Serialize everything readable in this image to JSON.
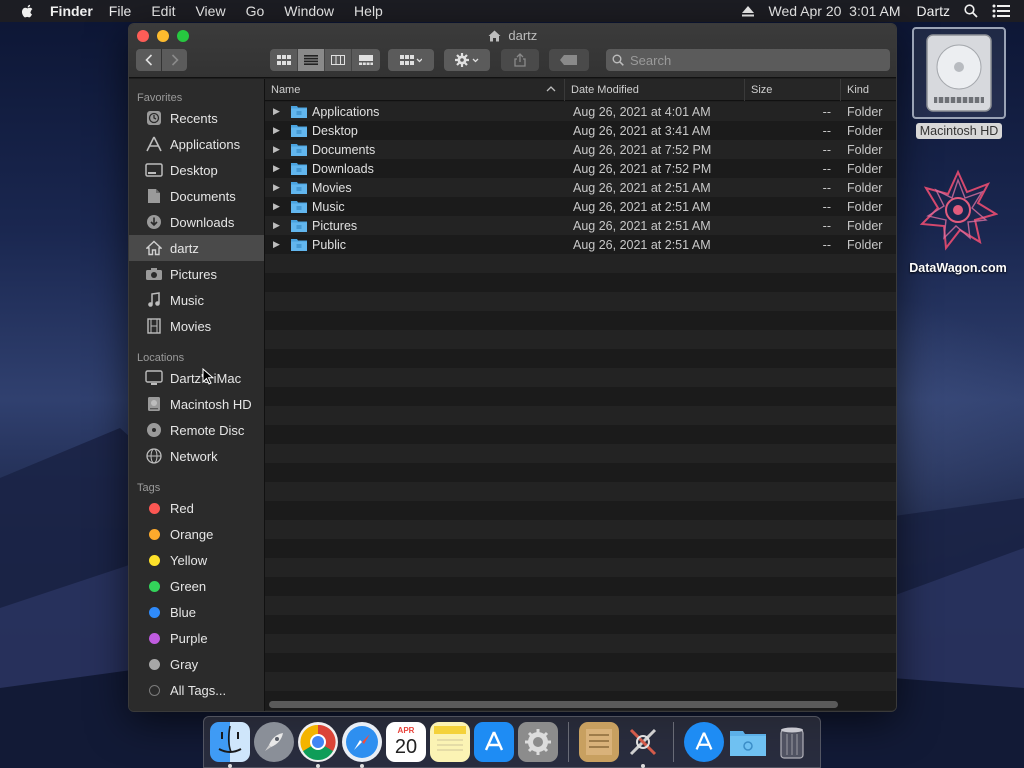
{
  "menubar": {
    "app_name": "Finder",
    "menus": [
      "File",
      "Edit",
      "View",
      "Go",
      "Window",
      "Help"
    ],
    "clock": "Wed Apr 20  3:01 AM",
    "user": "Dartz"
  },
  "window": {
    "title": "dartz",
    "search_placeholder": "Search"
  },
  "sidebar": {
    "favorites_header": "Favorites",
    "favorites": [
      {
        "label": "Recents",
        "icon": "clock-icon"
      },
      {
        "label": "Applications",
        "icon": "applications-icon"
      },
      {
        "label": "Desktop",
        "icon": "desktop-icon"
      },
      {
        "label": "Documents",
        "icon": "document-icon"
      },
      {
        "label": "Downloads",
        "icon": "download-icon"
      },
      {
        "label": "dartz",
        "icon": "home-icon"
      },
      {
        "label": "Pictures",
        "icon": "camera-icon"
      },
      {
        "label": "Music",
        "icon": "music-note-icon"
      },
      {
        "label": "Movies",
        "icon": "film-icon"
      }
    ],
    "locations_header": "Locations",
    "locations": [
      {
        "label": "Dartz's iMac",
        "icon": "imac-icon"
      },
      {
        "label": "Macintosh HD",
        "icon": "harddisk-icon"
      },
      {
        "label": "Remote Disc",
        "icon": "disc-icon"
      },
      {
        "label": "Network",
        "icon": "globe-icon"
      }
    ],
    "tags_header": "Tags",
    "tags": [
      {
        "label": "Red",
        "color": "#fc5753"
      },
      {
        "label": "Orange",
        "color": "#fdaa2c"
      },
      {
        "label": "Yellow",
        "color": "#fde12a"
      },
      {
        "label": "Green",
        "color": "#33d35a"
      },
      {
        "label": "Blue",
        "color": "#2f8bfb"
      },
      {
        "label": "Purple",
        "color": "#c05ce0"
      },
      {
        "label": "Gray",
        "color": "#a7a7a7"
      }
    ],
    "all_tags": "All Tags..."
  },
  "columns": {
    "name": "Name",
    "date": "Date Modified",
    "size": "Size",
    "kind": "Kind"
  },
  "files": [
    {
      "name": "Applications",
      "date": "Aug 26, 2021 at 4:01 AM",
      "size": "--",
      "kind": "Folder"
    },
    {
      "name": "Desktop",
      "date": "Aug 26, 2021 at 3:41 AM",
      "size": "--",
      "kind": "Folder"
    },
    {
      "name": "Documents",
      "date": "Aug 26, 2021 at 7:52 PM",
      "size": "--",
      "kind": "Folder"
    },
    {
      "name": "Downloads",
      "date": "Aug 26, 2021 at 7:52 PM",
      "size": "--",
      "kind": "Folder"
    },
    {
      "name": "Movies",
      "date": "Aug 26, 2021 at 2:51 AM",
      "size": "--",
      "kind": "Folder"
    },
    {
      "name": "Music",
      "date": "Aug 26, 2021 at 2:51 AM",
      "size": "--",
      "kind": "Folder"
    },
    {
      "name": "Pictures",
      "date": "Aug 26, 2021 at 2:51 AM",
      "size": "--",
      "kind": "Folder"
    },
    {
      "name": "Public",
      "date": "Aug 26, 2021 at 2:51 AM",
      "size": "--",
      "kind": "Folder"
    }
  ],
  "desktop": {
    "hd_label": "Macintosh HD",
    "datawagon_label": "DataWagon.com"
  },
  "dock": {
    "calendar_month": "APR",
    "calendar_day": "20"
  }
}
